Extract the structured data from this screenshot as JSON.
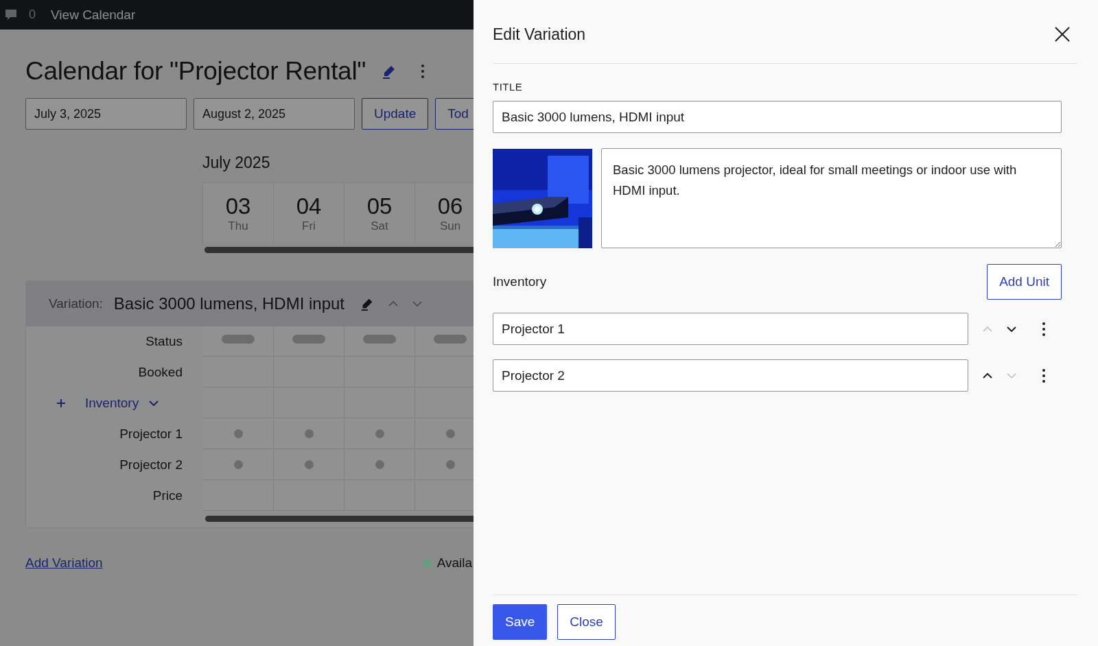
{
  "top_bar": {
    "comment_count": "0",
    "link": "View Calendar"
  },
  "page": {
    "title": "Calendar for \"Projector Rental\"",
    "start_date": "July 3, 2025",
    "end_date": "August 2, 2025",
    "buttons": [
      "Update",
      "Tod"
    ],
    "month": "July 2025",
    "days": [
      {
        "date": "03",
        "weekday": "Thu"
      },
      {
        "date": "04",
        "weekday": "Fri"
      },
      {
        "date": "05",
        "weekday": "Sat"
      },
      {
        "date": "06",
        "weekday": "Sun"
      }
    ],
    "variation": {
      "label": "Variation:",
      "name": "Basic 3000 lumens, HDMI input",
      "rows": [
        {
          "label": "Status",
          "kind": "status"
        },
        {
          "label": "Booked",
          "kind": "plain"
        },
        {
          "label": "Inventory",
          "kind": "group",
          "expanded": true
        },
        {
          "label": "Projector 1",
          "kind": "unit"
        },
        {
          "label": "Projector 2",
          "kind": "unit"
        },
        {
          "label": "Price",
          "kind": "plain"
        }
      ]
    },
    "add_variation": "Add Variation",
    "legend": [
      {
        "label": "Availa",
        "color": "#6a9a80"
      }
    ]
  },
  "panel": {
    "title": "Edit Variation",
    "title_label": "TITLE",
    "title_value": "Basic 3000 lumens, HDMI input",
    "description": "Basic 3000 lumens projector, ideal for small meetings or indoor use with HDMI input.",
    "inventory_label": "Inventory",
    "add_unit": "Add Unit",
    "units": [
      {
        "name": "Projector 1",
        "up_disabled": true,
        "down_disabled": false
      },
      {
        "name": "Projector 2",
        "up_disabled": false,
        "down_disabled": true
      }
    ],
    "buttons": [
      {
        "label": "Save",
        "kind": "primary"
      },
      {
        "label": "Close",
        "kind": "secondary"
      }
    ]
  }
}
